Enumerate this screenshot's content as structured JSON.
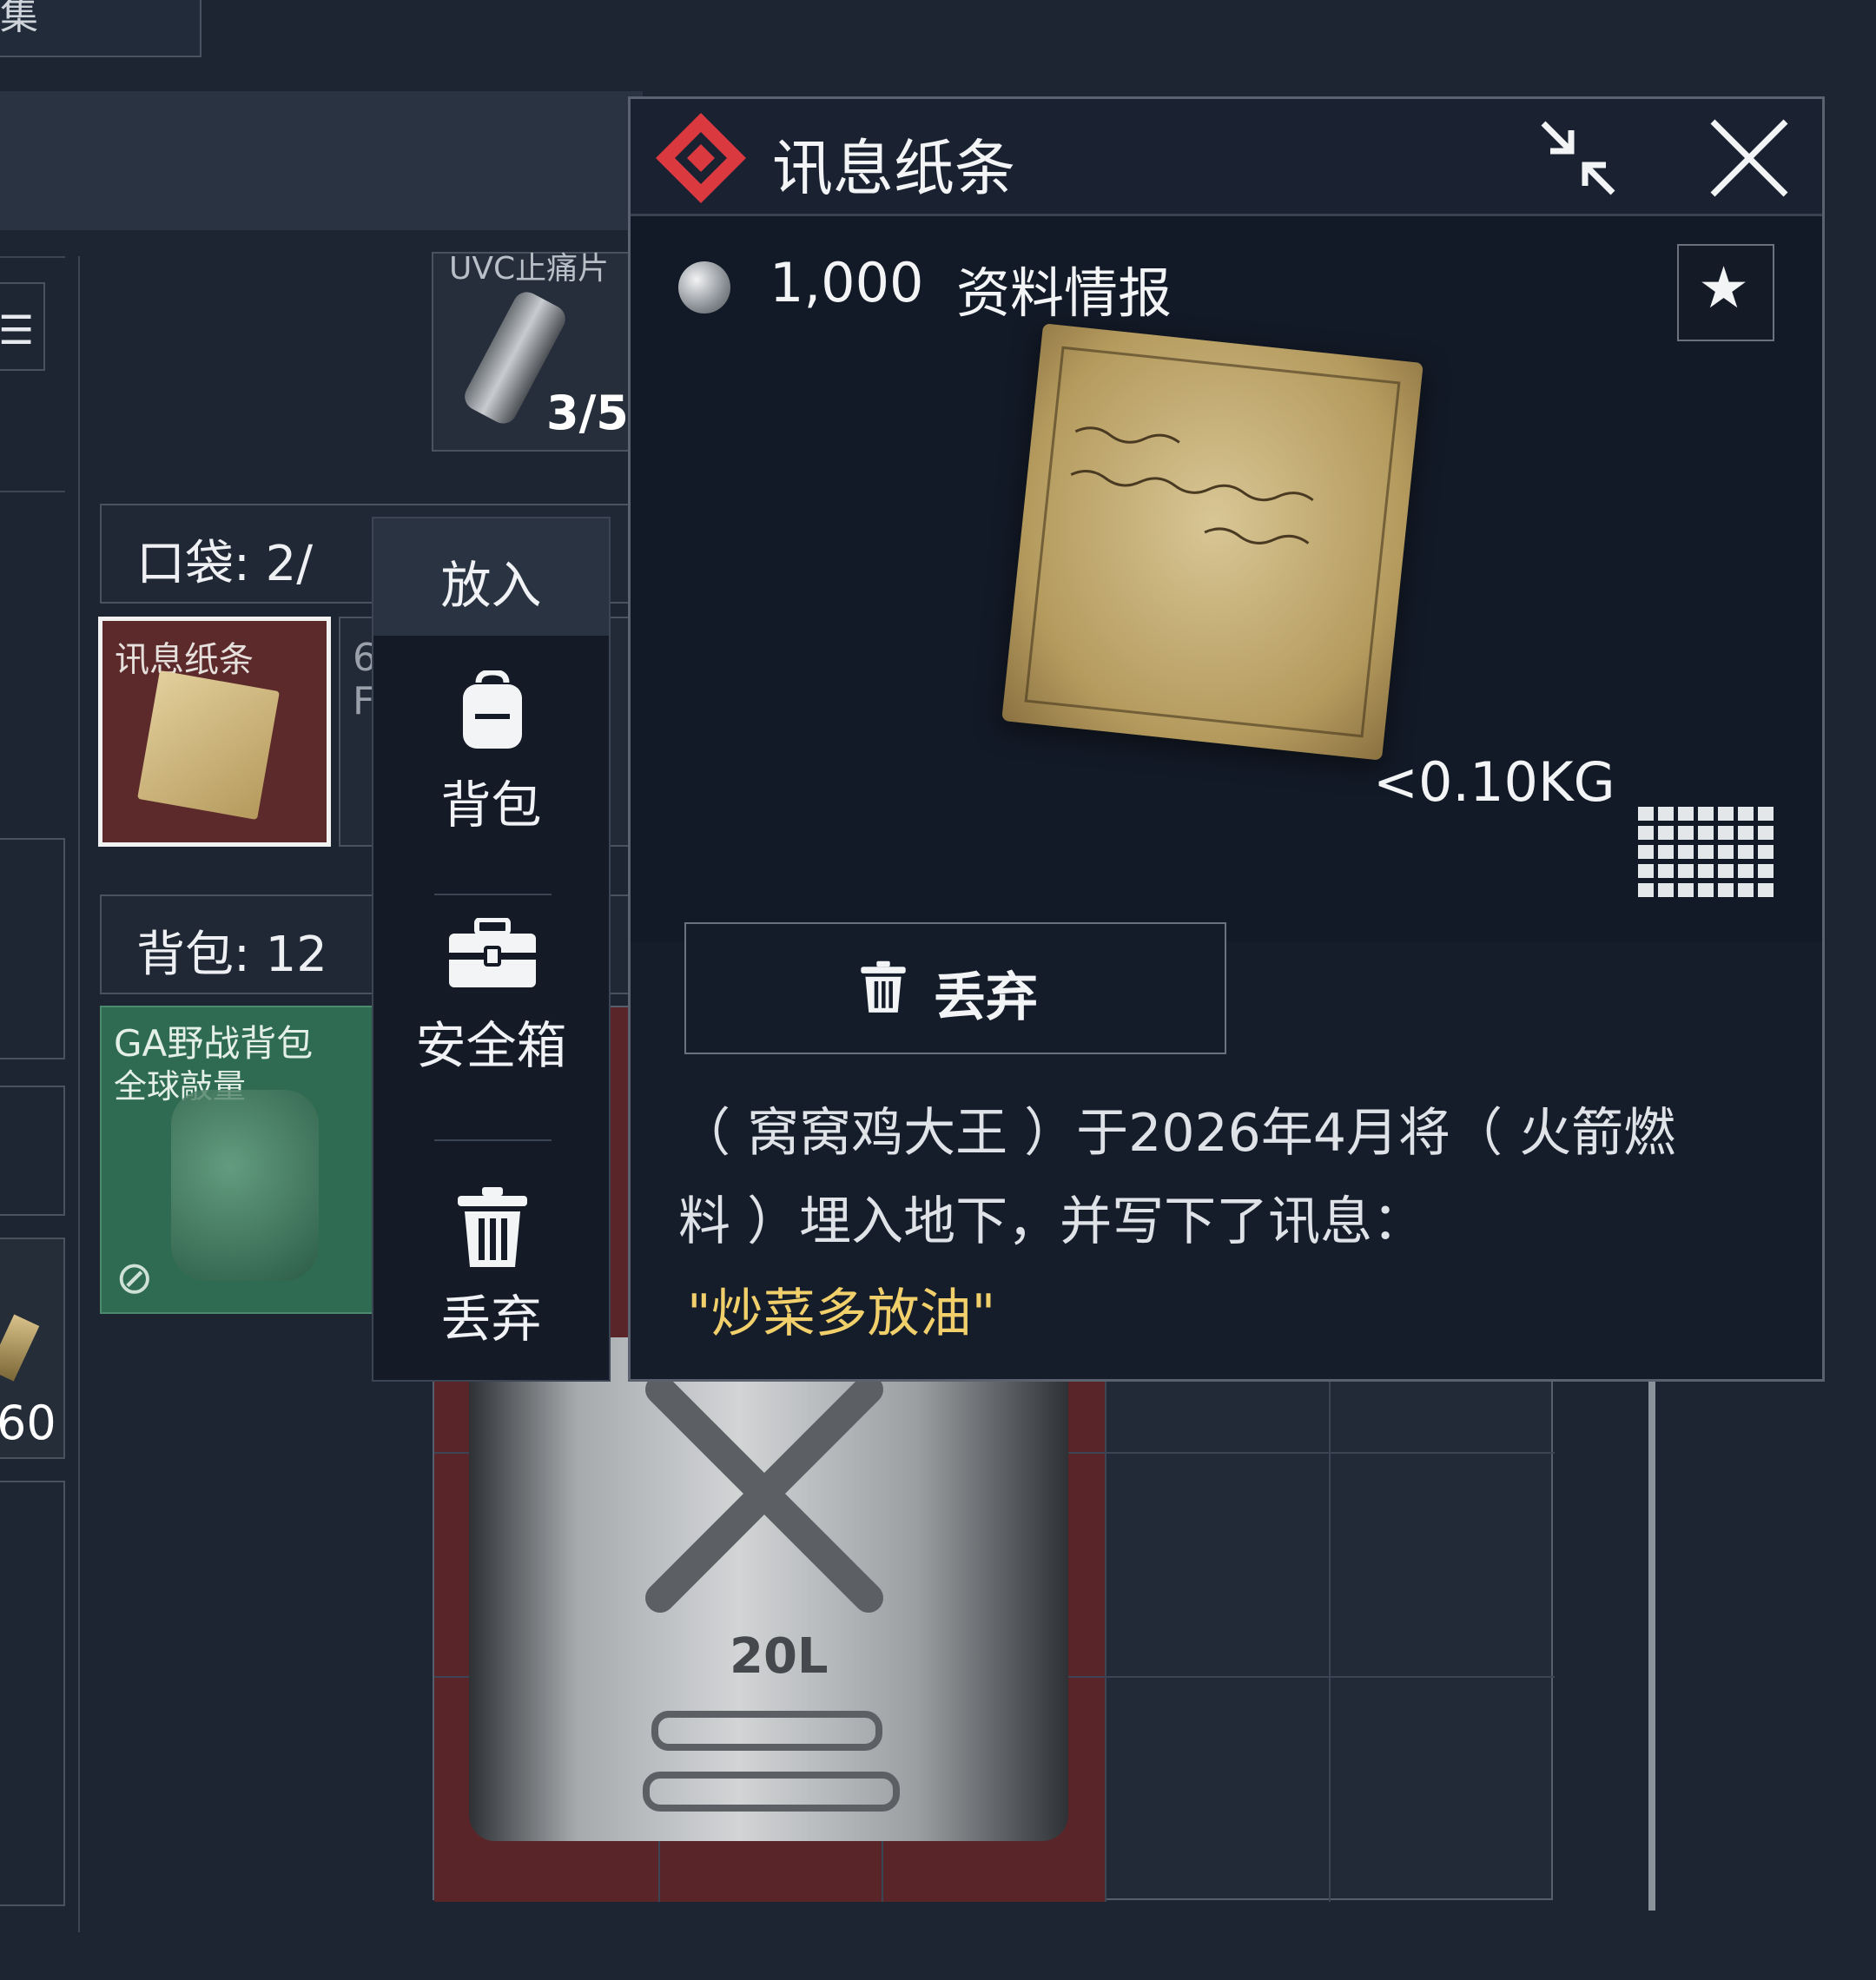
{
  "top_tab": {
    "label": "集"
  },
  "background": {
    "top_item": {
      "label": "UVC止痛片",
      "count": "3/5"
    },
    "pocket": {
      "label": "口袋: 2/",
      "item_name": "讯息纸条",
      "neighbor_text_1": "6",
      "neighbor_text_2": "F"
    },
    "backpack": {
      "label": "背包: 12",
      "item_name": "GA野战背包",
      "item_sub": "全球敲量"
    },
    "left_count": "60",
    "jerrycan_label": "20L"
  },
  "context_menu": {
    "title": "放入",
    "items": [
      {
        "label": "背包",
        "icon": "backpack-icon"
      },
      {
        "label": "安全箱",
        "icon": "safebox-icon"
      },
      {
        "label": "丢弃",
        "icon": "trash-icon"
      }
    ]
  },
  "detail": {
    "title": "讯息纸条",
    "price": "1,000",
    "category": "资料情报",
    "weight": "<0.10KG",
    "discard_button": "丢弃",
    "description": "（ 窝窝鸡大王 ）于2026年4月将（ 火箭燃料 ）埋入地下，并写下了讯息：",
    "quote": "\"炒菜多放油\""
  },
  "colors": {
    "accent_red": "#d9393f",
    "quote_gold": "#f1cf6b",
    "pocket_bg": "#5d2a2c",
    "backpack_bg": "#2f6b52"
  }
}
